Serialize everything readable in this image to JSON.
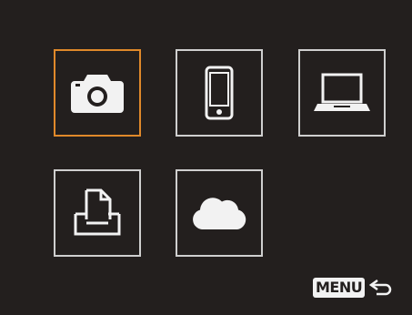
{
  "screen": {
    "background": "#231f1e",
    "selected_border_color": "#e0892a",
    "border_color": "#cfcfcf",
    "icon_color": "#f2f2f2"
  },
  "tiles": [
    {
      "id": "camera",
      "icon": "camera-icon",
      "selected": true
    },
    {
      "id": "smartphone",
      "icon": "smartphone-icon",
      "selected": false
    },
    {
      "id": "computer",
      "icon": "laptop-icon",
      "selected": false
    },
    {
      "id": "printer",
      "icon": "printer-icon",
      "selected": false
    },
    {
      "id": "web-service",
      "icon": "cloud-icon",
      "selected": false
    }
  ],
  "footer": {
    "menu_label": "MENU",
    "back_icon": "return-arrow-icon"
  }
}
